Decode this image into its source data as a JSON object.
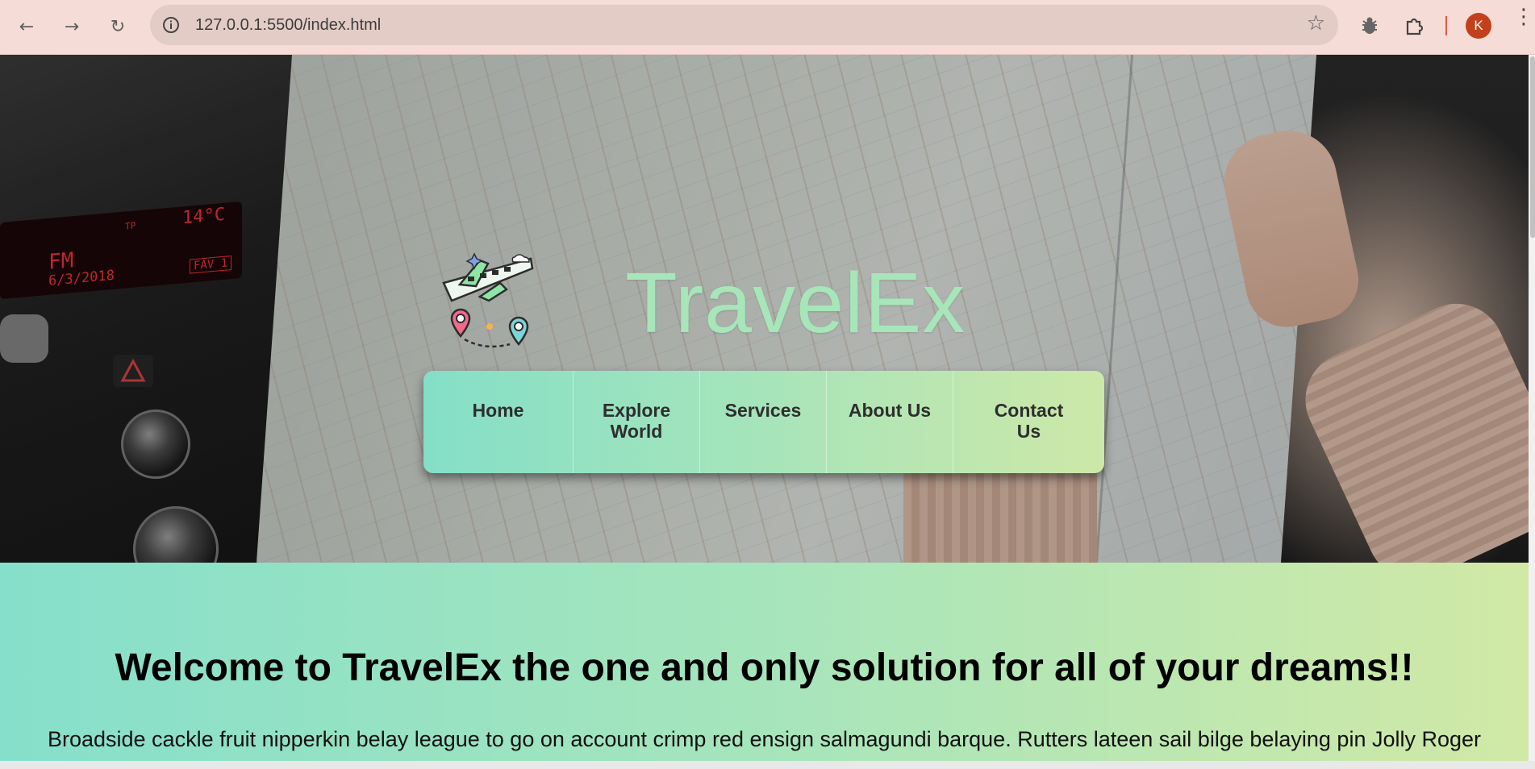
{
  "browser": {
    "url": "127.0.0.1:5500/index.html",
    "back_icon": "back-arrow-icon",
    "forward_icon": "forward-arrow-icon",
    "reload_icon": "reload-icon",
    "info_icon": "site-info-icon",
    "bookmark_icon": "star-icon",
    "extension_icons": [
      "bug-extension-icon",
      "puzzle-extensions-icon"
    ],
    "profile_initial": "K",
    "profile_color": "#c2411c",
    "menu_icon": "kebab-menu-icon"
  },
  "hero": {
    "title": "TravelEx",
    "title_color": "#a6e6b9",
    "logo_icon": "airplane-map-pins-icon",
    "background_image": "map-in-car-photo",
    "radio_text": [
      "TP",
      "14°C",
      "FM",
      "6/3/2018",
      "FAV 1"
    ]
  },
  "nav": {
    "items": [
      {
        "label": "Home"
      },
      {
        "label": "Explore World"
      },
      {
        "label": "Services"
      },
      {
        "label": "About Us"
      },
      {
        "label": "Contact Us"
      }
    ],
    "gradient_colors": [
      "#84dfc7",
      "#cde8a8"
    ]
  },
  "welcome": {
    "heading": "Welcome to TravelEx the one and only solution for all of your dreams!!",
    "paragraph": "Broadside cackle fruit nipperkin belay league to go on account crimp red ensign salmagundi barque. Rutters lateen sail bilge belaying pin Jolly Roger"
  }
}
